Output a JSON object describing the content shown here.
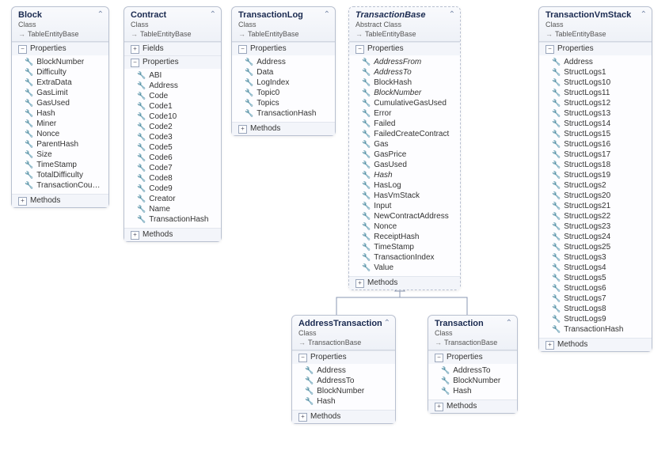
{
  "labels": {
    "class": "Class",
    "abstract": "Abstract Class",
    "props": "Properties",
    "methods": "Methods",
    "fields": "Fields",
    "baseTE": "TableEntityBase",
    "baseTB": "TransactionBase"
  },
  "boxes": {
    "block": {
      "title": "Block",
      "props": [
        "BlockNumber",
        "Difficulty",
        "ExtraData",
        "GasLimit",
        "GasUsed",
        "Hash",
        "Miner",
        "Nonce",
        "ParentHash",
        "Size",
        "TimeStamp",
        "TotalDifficulty",
        "TransactionCou…"
      ]
    },
    "contract": {
      "title": "Contract",
      "props": [
        "ABI",
        "Address",
        "Code",
        "Code1",
        "Code10",
        "Code2",
        "Code3",
        "Code5",
        "Code6",
        "Code7",
        "Code8",
        "Code9",
        "Creator",
        "Name",
        "TransactionHash"
      ]
    },
    "txlog": {
      "title": "TransactionLog",
      "props": [
        "Address",
        "Data",
        "LogIndex",
        "Topic0",
        "Topics",
        "TransactionHash"
      ]
    },
    "txbase": {
      "title": "TransactionBase",
      "props": [
        [
          "AddressFrom",
          1
        ],
        [
          "AddressTo",
          1
        ],
        [
          "BlockHash",
          0
        ],
        [
          "BlockNumber",
          1
        ],
        [
          "CumulativeGasUsed",
          0
        ],
        [
          "Error",
          0
        ],
        [
          "Failed",
          0
        ],
        [
          "FailedCreateContract",
          0
        ],
        [
          "Gas",
          0
        ],
        [
          "GasPrice",
          0
        ],
        [
          "GasUsed",
          0
        ],
        [
          "Hash",
          1
        ],
        [
          "HasLog",
          0
        ],
        [
          "HasVmStack",
          0
        ],
        [
          "Input",
          0
        ],
        [
          "NewContractAddress",
          0
        ],
        [
          "Nonce",
          0
        ],
        [
          "ReceiptHash",
          0
        ],
        [
          "TimeStamp",
          0
        ],
        [
          "TransactionIndex",
          0
        ],
        [
          "Value",
          0
        ]
      ]
    },
    "addrtx": {
      "title": "AddressTransaction",
      "props": [
        "Address",
        "AddressTo",
        "BlockNumber",
        "Hash"
      ]
    },
    "tx": {
      "title": "Transaction",
      "props": [
        "AddressTo",
        "BlockNumber",
        "Hash"
      ]
    },
    "vmstack": {
      "title": "TransactionVmStack",
      "props": [
        "Address",
        "StructLogs1",
        "StructLogs10",
        "StructLogs11",
        "StructLogs12",
        "StructLogs13",
        "StructLogs14",
        "StructLogs15",
        "StructLogs16",
        "StructLogs17",
        "StructLogs18",
        "StructLogs19",
        "StructLogs2",
        "StructLogs20",
        "StructLogs21",
        "StructLogs22",
        "StructLogs23",
        "StructLogs24",
        "StructLogs25",
        "StructLogs3",
        "StructLogs4",
        "StructLogs5",
        "StructLogs6",
        "StructLogs7",
        "StructLogs8",
        "StructLogs9",
        "TransactionHash"
      ]
    }
  }
}
